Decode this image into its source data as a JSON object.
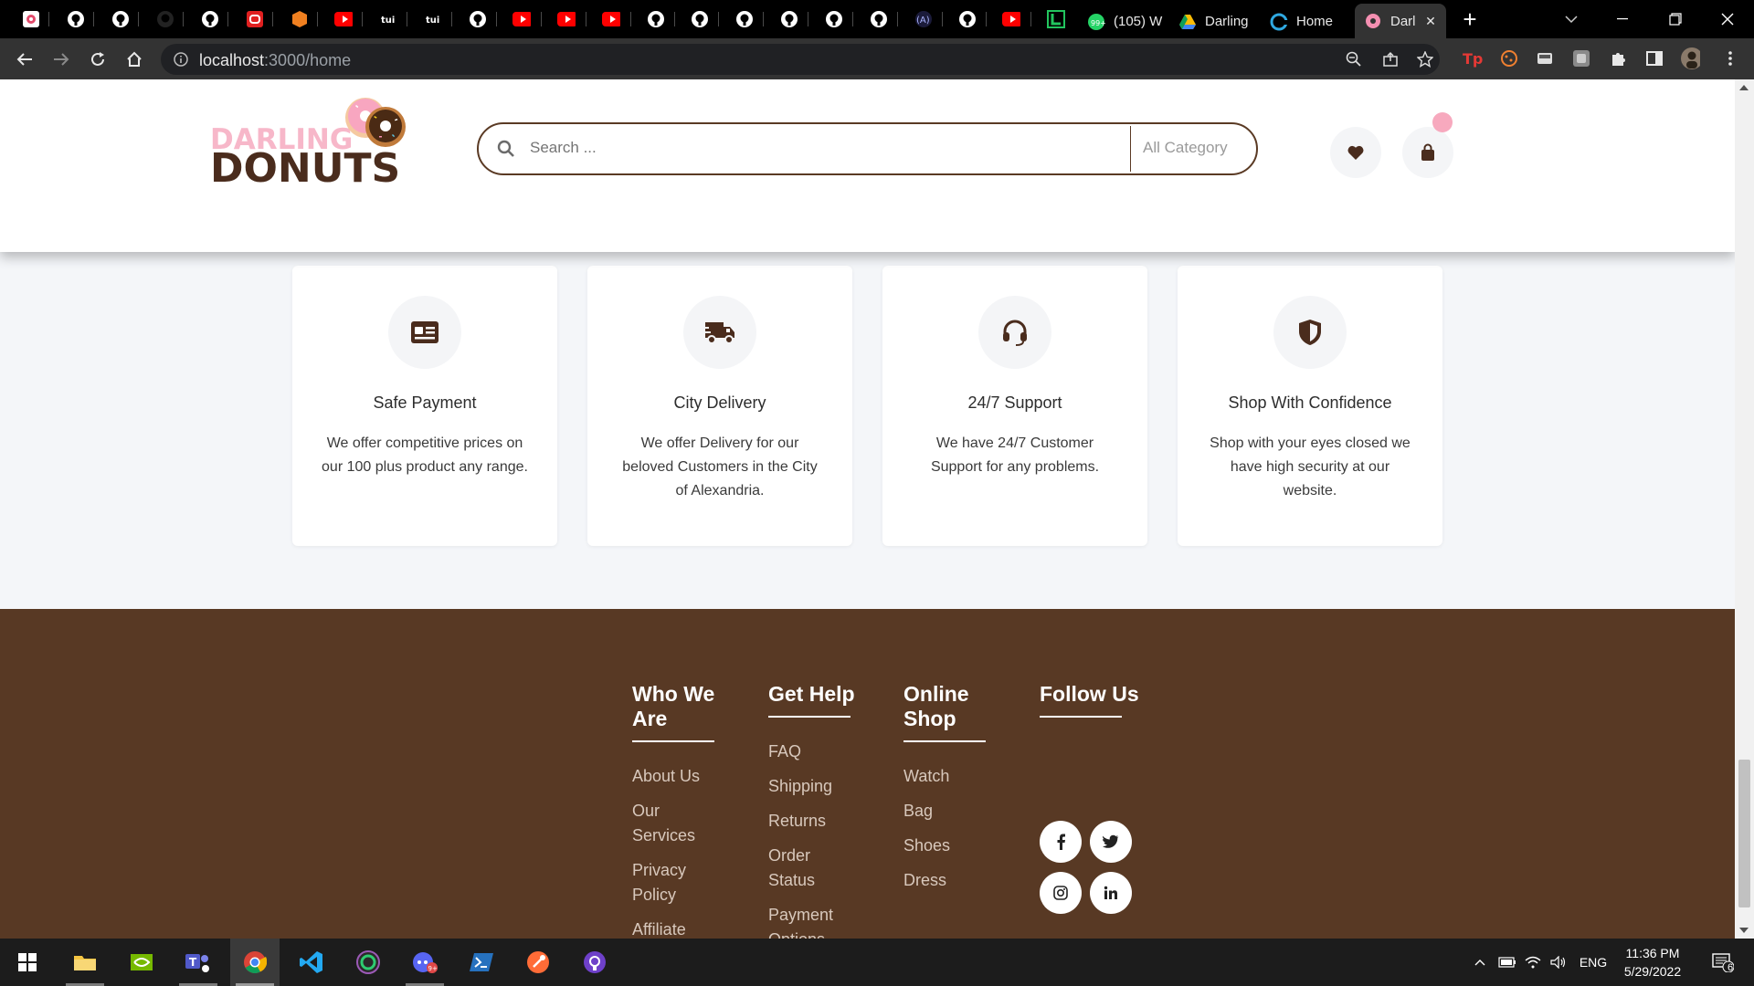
{
  "browser": {
    "tabs": [
      {
        "label": "(105) W",
        "icon": "whatsapp-icon"
      },
      {
        "label": "Darling",
        "icon": "google-drive-icon"
      },
      {
        "label": "Home",
        "icon": "edge-icon"
      }
    ],
    "active_tab": {
      "label": "Darl",
      "icon": "donut-favicon"
    },
    "url_host": "localhost",
    "url_path": ":3000/home"
  },
  "header": {
    "logo_top": "DARLING",
    "logo_bottom": "DONUTS",
    "search_placeholder": "Search ...",
    "category_label": "All Category"
  },
  "features": [
    {
      "title": "Safe Payment",
      "desc": "We offer competitive prices on our 100 plus product any range.",
      "icon": "id-card-icon"
    },
    {
      "title": "City Delivery",
      "desc": "We offer Delivery for our beloved Customers in the City of Alexandria.",
      "icon": "truck-icon"
    },
    {
      "title": "24/7 Support",
      "desc": "We have 24/7 Customer Support for any problems.",
      "icon": "headset-icon"
    },
    {
      "title": "Shop With Confidence",
      "desc": "Shop with your eyes closed we have high security at our website.",
      "icon": "shield-icon"
    }
  ],
  "footer": {
    "who_we_are": {
      "heading": "Who We Are",
      "links": [
        "About Us",
        "Our Services",
        "Privacy Policy",
        "Affiliate Program"
      ]
    },
    "get_help": {
      "heading": "Get Help",
      "links": [
        "FAQ",
        "Shipping",
        "Returns",
        "Order Status",
        "Payment Options"
      ]
    },
    "online_shop": {
      "heading": "Online Shop",
      "links": [
        "Watch",
        "Bag",
        "Shoes",
        "Dress"
      ]
    },
    "follow_us": {
      "heading": "Follow Us",
      "socials": [
        "facebook-icon",
        "twitter-icon",
        "instagram-icon",
        "linkedin-icon"
      ]
    }
  },
  "taskbar": {
    "language": "ENG",
    "time": "11:36 PM",
    "date": "5/29/2022",
    "notification_count": "6"
  },
  "colors": {
    "brand_brown": "#583924",
    "logo_pink": "#f7b7c9",
    "page_bg": "#f4f6f9"
  }
}
